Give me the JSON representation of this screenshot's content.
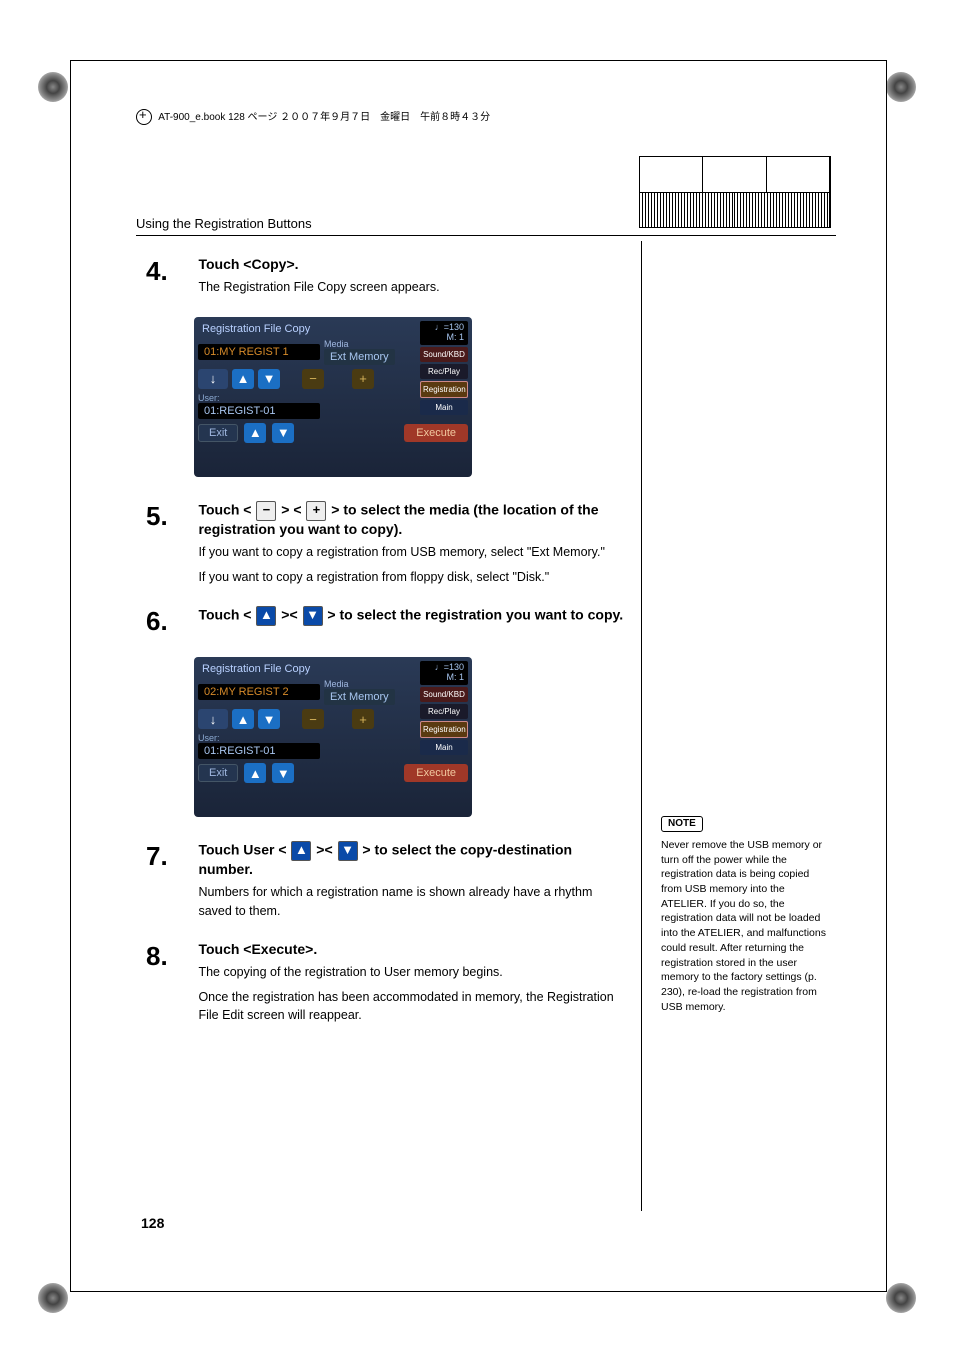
{
  "header_meta": "AT-900_e.book  128 ページ  ２００７年９月７日　金曜日　午前８時４３分",
  "section_title": "Using the Registration Buttons",
  "page_number": "128",
  "steps": {
    "s4": {
      "num": "4.",
      "head": "Touch <Copy>.",
      "text": "The Registration File Copy screen appears."
    },
    "s5": {
      "num": "5.",
      "head_before": "Touch <",
      "head_mid": "> <",
      "head_after": "> to select the media (the location of the registration you want to copy).",
      "text1": "If you want to copy a registration from USB memory, select \"Ext Memory.\"",
      "text2": "If you want to copy a registration from floppy disk, select \"Disk.\""
    },
    "s6": {
      "num": "6.",
      "head_before": "Touch <",
      "head_mid": "><",
      "head_after": "> to select the registration you want to copy."
    },
    "s7": {
      "num": "7.",
      "head_before": "Touch User <",
      "head_mid": "><",
      "head_after": "> to select the copy-destination number.",
      "text": "Numbers for which a registration name is shown already have a rhythm saved to them."
    },
    "s8": {
      "num": "8.",
      "head": "Touch <Execute>.",
      "text1": "The copying of the registration to User memory begins.",
      "text2": "Once the registration has been accommodated in memory, the Registration File Edit screen will reappear."
    }
  },
  "screen1": {
    "title": "Registration File Copy",
    "reg": "01:MY REGIST 1",
    "media_label": "Media",
    "media": "Ext Memory",
    "user_label": "User:",
    "user": "01:REGIST-01",
    "exit": "Exit",
    "execute": "Execute",
    "tempo": "♩=130",
    "measure": "M:    1",
    "tabs": {
      "sound": "Sound/KBD",
      "rec": "Rec/Play",
      "reg": "Registration",
      "main": "Main"
    }
  },
  "screen2": {
    "title": "Registration File Copy",
    "reg": "02:MY REGIST 2",
    "media_label": "Media",
    "media": "Ext Memory",
    "user_label": "User:",
    "user": "01:REGIST-01",
    "exit": "Exit",
    "execute": "Execute",
    "tempo": "♩=130",
    "measure": "M:    1",
    "tabs": {
      "sound": "Sound/KBD",
      "rec": "Rec/Play",
      "reg": "Registration",
      "main": "Main"
    }
  },
  "note": {
    "label": "NOTE",
    "text": "Never remove the USB memory or turn off the power while the registration data is being copied from USB memory into the ATELIER. If you do so, the registration data will not be loaded into the ATELIER, and malfunctions could result. After returning the registration stored in the user memory to the factory settings (p. 230), re-load the registration from USB memory."
  }
}
